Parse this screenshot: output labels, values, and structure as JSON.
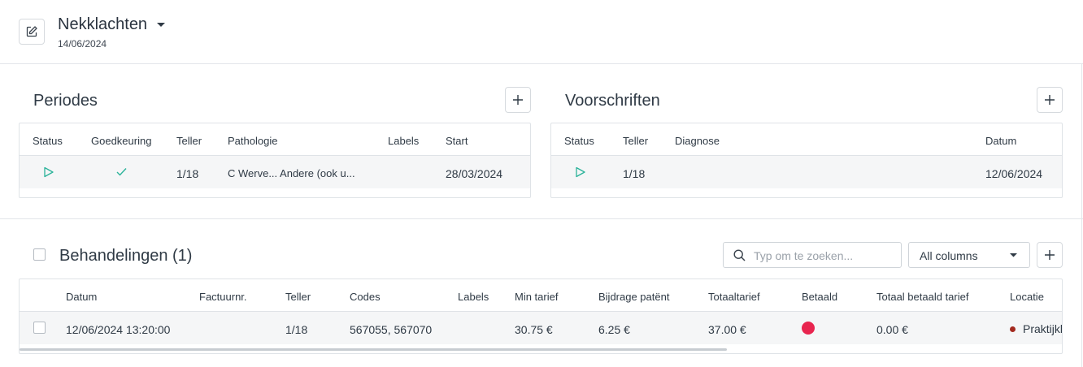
{
  "header": {
    "title": "Nekklachten",
    "date": "14/06/2024"
  },
  "periodes": {
    "title": "Periodes",
    "columns": [
      "Status",
      "Goedkeuring",
      "Teller",
      "Pathologie",
      "Labels",
      "Start"
    ],
    "row": {
      "status_icon": "play-icon",
      "approval_icon": "checkmark-icon",
      "teller": "1/18",
      "pathologie": "C Werve... Andere (ook u...",
      "labels": "",
      "start": "28/03/2024"
    }
  },
  "voorschriften": {
    "title": "Voorschriften",
    "columns": [
      "Status",
      "Teller",
      "Diagnose",
      "Datum"
    ],
    "row": {
      "status_icon": "play-icon",
      "teller": "1/18",
      "diagnose": "",
      "datum": "12/06/2024"
    }
  },
  "behandelingen": {
    "title": "Behandelingen (1)",
    "search_placeholder": "Typ om te zoeken...",
    "filter_value": "All columns",
    "columns": [
      "Datum",
      "Factuurnr.",
      "Teller",
      "Codes",
      "Labels",
      "Min tarief",
      "Bijdrage patënt",
      "Totaaltarief",
      "Betaald",
      "Totaal betaald tarief",
      "Locatie"
    ],
    "row": {
      "datum": "12/06/2024 13:20:00",
      "factuurnr": "",
      "teller": "1/18",
      "codes": "567055, 567070",
      "labels": "",
      "min_tarief": "30.75 €",
      "bijdrage": "6.25 €",
      "totaaltarief": "37.00 €",
      "betaald_status": "unpaid",
      "totaal_betaald": "0.00 €",
      "locatie": "Praktijkk"
    }
  },
  "colors": {
    "accent_teal": "#2bb39a",
    "unpaid_red": "#e8254f",
    "location_dot": "#a32a1f"
  }
}
